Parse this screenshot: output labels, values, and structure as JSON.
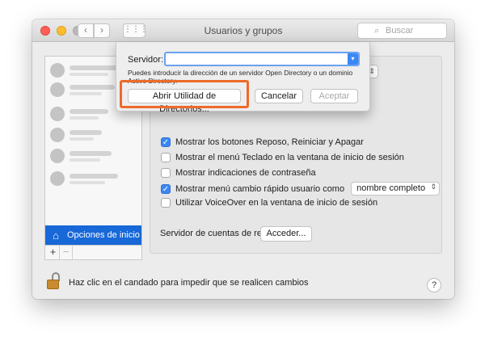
{
  "window": {
    "title": "Usuarios y grupos",
    "nav_back": "‹",
    "nav_forward": "›",
    "grid_icon": "⋮⋮⋮",
    "search_placeholder": "Buscar"
  },
  "sheet": {
    "server_label": "Servidor:",
    "server_value": "",
    "help_text": "Puedes introducir la dirección de un servidor Open Directory o un dominio Active Directory.",
    "open_utility_button": "Abrir Utilidad de Directorios...",
    "cancel_button": "Cancelar",
    "accept_button": "Aceptar"
  },
  "sidebar": {
    "selected_item": "Opciones de inicio",
    "add_button": "+",
    "remove_button": "−"
  },
  "options": [
    {
      "label": "Mostrar los botones Reposo, Reiniciar y Apagar",
      "checked": true
    },
    {
      "label": "Mostrar el menú Teclado en la ventana de inicio de sesión",
      "checked": false
    },
    {
      "label": "Mostrar indicaciones de contraseña",
      "checked": false
    },
    {
      "label": "Mostrar menú cambio rápido usuario como",
      "checked": true,
      "select_value": "nombre completo"
    },
    {
      "label": "Utilizar VoiceOver en la ventana de inicio de sesión",
      "checked": false
    }
  ],
  "network": {
    "label": "Servidor de cuentas de red:",
    "button": "Acceder..."
  },
  "footer": {
    "lock_text": "Haz clic en el candado para impedir que se realicen cambios",
    "help_button": "?"
  },
  "colors": {
    "selection": "#1868d8",
    "highlight_box": "#ee6a2a",
    "checkbox_on": "#3b87f4"
  }
}
